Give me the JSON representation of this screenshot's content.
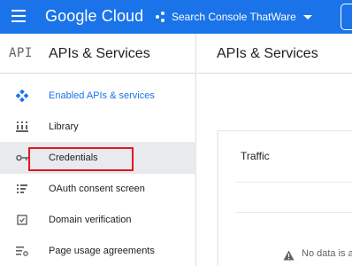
{
  "topbar": {
    "brand": "Google Cloud",
    "project": "Search Console ThatWare",
    "menu_icon": "hamburger-menu-icon",
    "project_icon": "project-nodes-icon",
    "colors": {
      "bar": "#1a73e8",
      "text": "#ffffff"
    }
  },
  "sidebar": {
    "logo": "API",
    "title": "APIs & Services",
    "items": [
      {
        "label": "Enabled APIs & services",
        "icon": "diamond-nodes-icon",
        "state": "active"
      },
      {
        "label": "Library",
        "icon": "library-icon",
        "state": ""
      },
      {
        "label": "Credentials",
        "icon": "key-icon",
        "state": "selected"
      },
      {
        "label": "OAuth consent screen",
        "icon": "consent-screen-icon",
        "state": ""
      },
      {
        "label": "Domain verification",
        "icon": "verification-checkbox-icon",
        "state": ""
      },
      {
        "label": "Page usage agreements",
        "icon": "settings-list-icon",
        "state": ""
      }
    ],
    "colors": {
      "active": "#1a73e8",
      "selected_bg": "#e8eaed",
      "highlight": "#e8141c"
    }
  },
  "main": {
    "title": "APIs & Services",
    "card": {
      "title": "Traffic",
      "empty_text": "No data is a",
      "warn_icon": "warning-icon"
    }
  }
}
